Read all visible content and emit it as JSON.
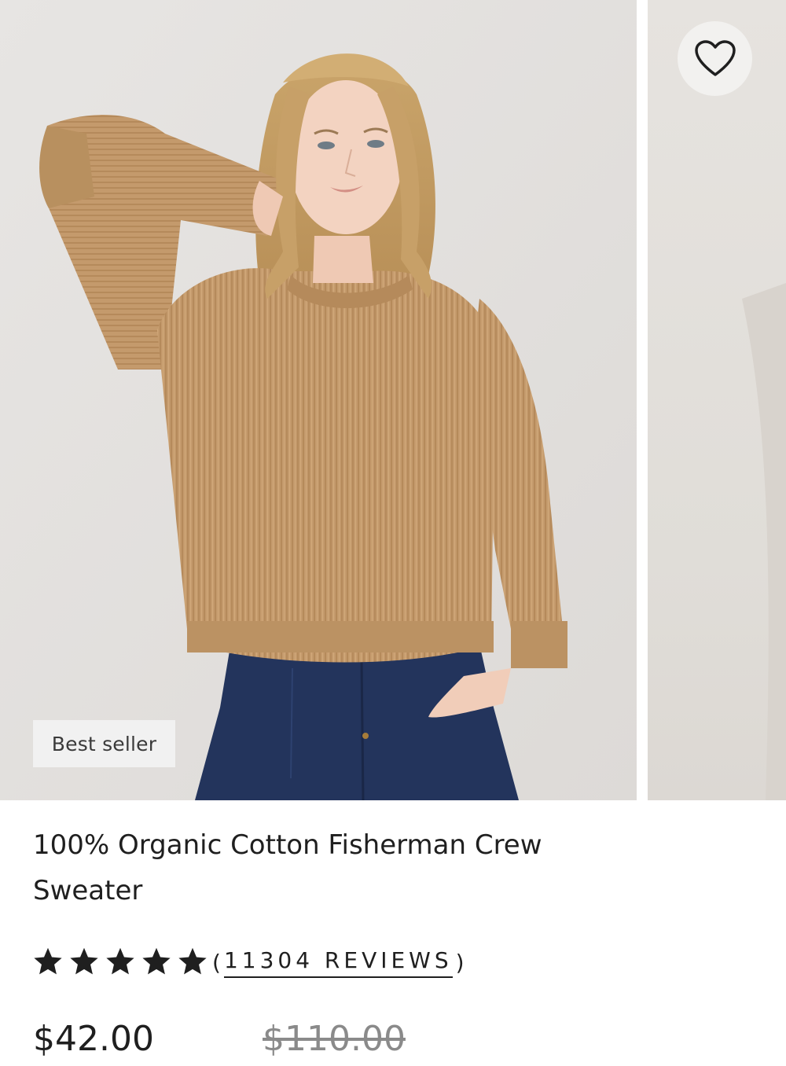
{
  "product": {
    "badge": "Best seller",
    "title_line1": "100% Organic Cotton Fisherman Crew",
    "title_line2": "Sweater",
    "rating": {
      "stars": 5,
      "max_stars": 5,
      "review_count": "11304",
      "reviews_label": "REVIEWS",
      "open_paren": "(",
      "close_paren": ")"
    },
    "price": "$42.00",
    "compare_price": "$110.00"
  },
  "icons": {
    "favorite": "heart-outline-icon",
    "star": "star-filled-icon"
  },
  "colors": {
    "text": "#1f1f1f",
    "muted_price": "#8a8a8a",
    "photo_background": "#e4e2e0",
    "sweater": "#c49a6c",
    "denim": "#23345c",
    "badge_background": "#f1f1f1"
  }
}
